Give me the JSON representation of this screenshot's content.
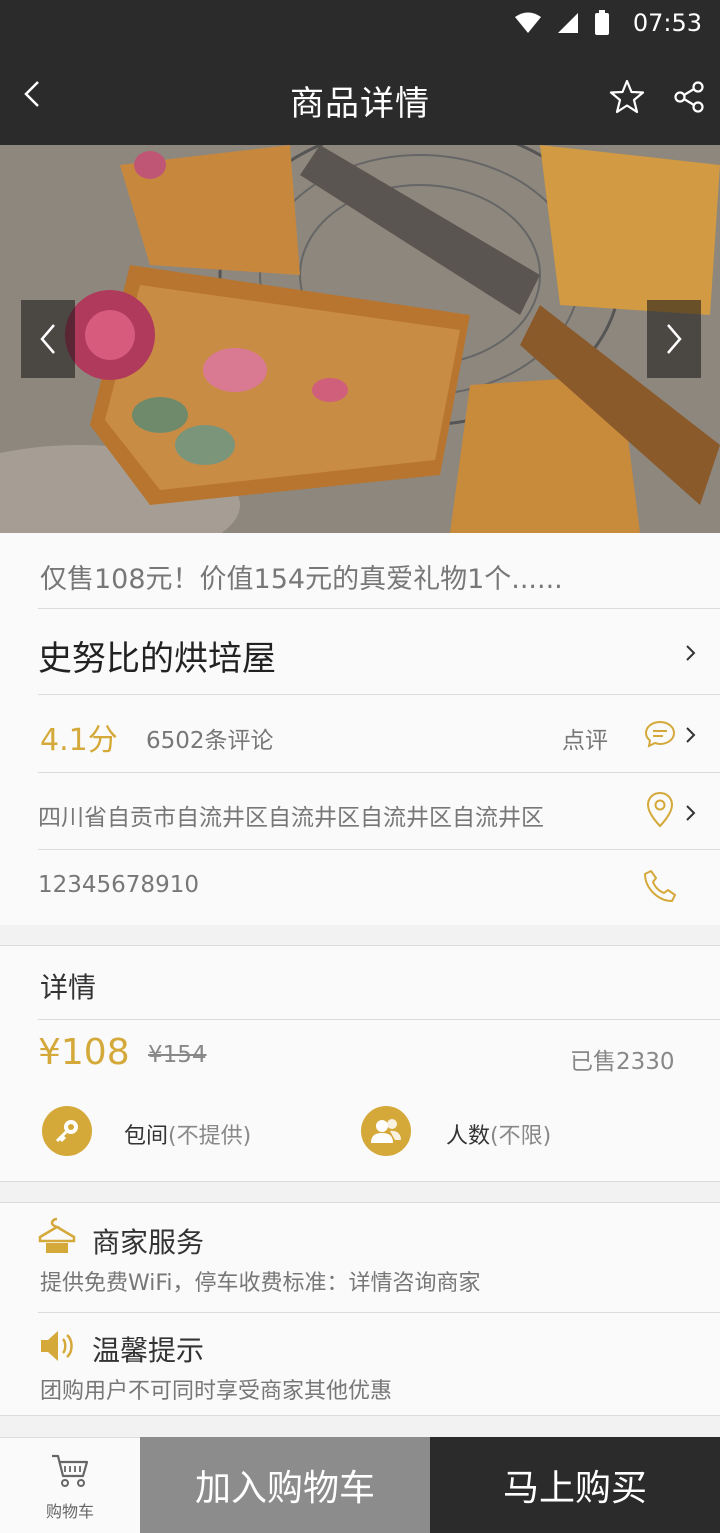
{
  "status_bar": {
    "time": "07:53",
    "icons": [
      "wifi-icon",
      "signal-icon",
      "battery-icon"
    ]
  },
  "nav": {
    "title": "商品详情",
    "icons": [
      "back-icon",
      "star-icon",
      "share-icon"
    ]
  },
  "hero": {
    "icons": [
      "chevron-left-icon",
      "chevron-right-icon"
    ]
  },
  "product": {
    "promo": "仅售108元！价值154元的真爱礼物1个......",
    "shop_name": "史努比的烘培屋",
    "score": "4.1分",
    "reviews": "6502条评论",
    "review_link": "点评",
    "address": "四川省自贡市自流井区自流井区自流井区自流井区",
    "phone": "12345678910"
  },
  "detail": {
    "heading": "详情",
    "price": "¥108",
    "original_price": "¥154",
    "sold": "已售2330",
    "features": [
      {
        "label": "包间",
        "note": "(不提供)",
        "icon": "key-icon"
      },
      {
        "label": "人数",
        "note": "(不限)",
        "icon": "people-icon"
      }
    ]
  },
  "service": {
    "merchant_title": "商家服务",
    "merchant_desc": "提供免费WiFi，停车收费标准：详情咨询商家",
    "tip_title": "温馨提示",
    "tip_desc": "团购用户不可同时享受商家其他优惠"
  },
  "bottom": {
    "cart_label": "购物车",
    "add_to_cart": "加入购物车",
    "buy_now": "马上购买"
  },
  "colors": {
    "accent": "#d4a93a",
    "dark": "#2b2b2b",
    "gray_button": "#8c8c8c"
  }
}
